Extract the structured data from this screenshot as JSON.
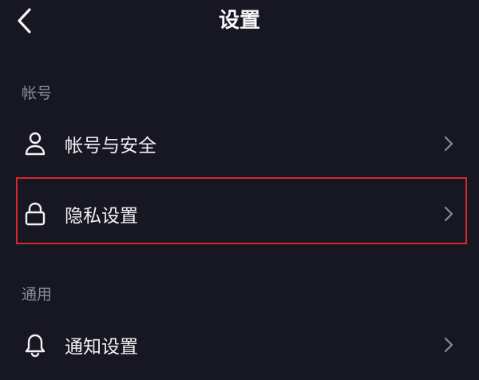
{
  "header": {
    "title": "设置",
    "back_icon": "chevron-left-icon"
  },
  "sections": [
    {
      "title": "帐号",
      "items": [
        {
          "label": "帐号与安全",
          "icon": "user-icon"
        },
        {
          "label": "隐私设置",
          "icon": "lock-icon",
          "highlighted": true
        }
      ]
    },
    {
      "title": "通用",
      "items": [
        {
          "label": "通知设置",
          "icon": "bell-icon"
        }
      ]
    }
  ],
  "colors": {
    "background": "#161722",
    "text_primary": "#f2f2f5",
    "text_secondary": "#8a8b93",
    "chevron": "#8a8b93",
    "highlight_border": "#d8262c"
  }
}
